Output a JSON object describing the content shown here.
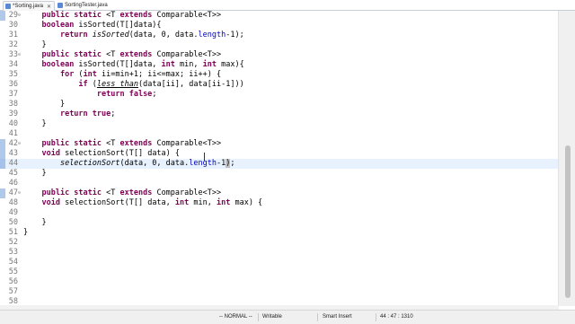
{
  "tabs": [
    {
      "label": "*Sorting.java",
      "active": true,
      "close": "✕"
    },
    {
      "label": "SortingTester.java",
      "active": false
    }
  ],
  "editor": {
    "current_line": 44,
    "lines": [
      {
        "n": "29",
        "fold": "⊖",
        "marker": true,
        "html": "    <span class=\"kw\">public static</span> &lt;T <span class=\"kw\">extends</span> Comparable&lt;T&gt;&gt;"
      },
      {
        "n": "30",
        "html": "    <span class=\"kw\">boolean</span> isSorted(T[]data){"
      },
      {
        "n": "31",
        "html": "        <span class=\"kw\">return</span> <span class=\"it\">isSorted</span>(data, 0, data.<span class=\"blu\">length</span>-1);"
      },
      {
        "n": "32",
        "html": "    }"
      },
      {
        "n": "33",
        "fold": "⊖",
        "html": "    <span class=\"kw\">public static</span> &lt;T <span class=\"kw\">extends</span> Comparable&lt;T&gt;&gt;"
      },
      {
        "n": "34",
        "html": "    <span class=\"kw\">boolean</span> isSorted(T[]data, <span class=\"kw\">int</span> min, <span class=\"kw\">int</span> max){"
      },
      {
        "n": "35",
        "html": "        <span class=\"kw\">for</span> (<span class=\"kw\">int</span> ii=min+1; ii&lt;=max; ii++) {"
      },
      {
        "n": "36",
        "html": "            <span class=\"kw\">if</span> (<span class=\"it-u\">less_than</span>(data[ii], data[ii-1]))"
      },
      {
        "n": "37",
        "html": "                <span class=\"kw\">return false</span>;"
      },
      {
        "n": "38",
        "html": "        }"
      },
      {
        "n": "39",
        "html": "        <span class=\"kw\">return true</span>;"
      },
      {
        "n": "40",
        "html": "    }"
      },
      {
        "n": "41",
        "html": ""
      },
      {
        "n": "42",
        "fold": "⊖",
        "marker": true,
        "html": "    <span class=\"kw\">public static</span> &lt;T <span class=\"kw\">extends</span> Comparable&lt;T&gt;&gt;"
      },
      {
        "n": "43",
        "marker": true,
        "html": "    <span class=\"kw\">void</span> selectionSort(T[] data) {"
      },
      {
        "n": "44",
        "marker": true,
        "html": "        <span class=\"it\">selectionSort</span>(data, 0, data.<span class=\"blu\">length</span>-1<span class=\"caret-box\">)</span>;"
      },
      {
        "n": "45",
        "html": "    }"
      },
      {
        "n": "46",
        "html": ""
      },
      {
        "n": "47",
        "fold": "⊖",
        "marker": true,
        "html": "    <span class=\"kw\">public static</span> &lt;T <span class=\"kw\">extends</span> Comparable&lt;T&gt;&gt;"
      },
      {
        "n": "48",
        "html": "    <span class=\"kw\">void</span> selectionSort(T[] data, <span class=\"kw\">int</span> min, <span class=\"kw\">int</span> max) {"
      },
      {
        "n": "49",
        "html": ""
      },
      {
        "n": "50",
        "html": "    }"
      },
      {
        "n": "51",
        "html": "}"
      },
      {
        "n": "52",
        "html": ""
      },
      {
        "n": "53",
        "html": ""
      },
      {
        "n": "54",
        "html": ""
      },
      {
        "n": "55",
        "html": ""
      },
      {
        "n": "56",
        "html": ""
      },
      {
        "n": "57",
        "html": ""
      },
      {
        "n": "58",
        "html": ""
      }
    ]
  },
  "status": {
    "mode": "-- NORMAL --",
    "writable": "Writable",
    "insert": "Smart Insert",
    "position": "44 : 47 : 1310"
  },
  "colors": {
    "keyword": "#7f0055",
    "field": "#0000c0",
    "current_line": "#e8f2fe"
  }
}
